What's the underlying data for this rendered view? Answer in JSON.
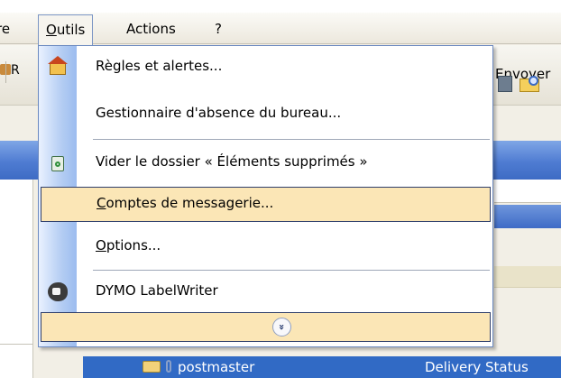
{
  "menubar": {
    "items": [
      {
        "label": "re"
      },
      {
        "label": "Outils"
      },
      {
        "label": "Actions"
      },
      {
        "label": "?"
      }
    ]
  },
  "toolbar": {
    "partial_left": "R",
    "partial_right": "Envoyer"
  },
  "dropdown": {
    "items": [
      {
        "label": "Règles et alertes...",
        "icon": "rules-icon"
      },
      {
        "label": "Gestionnaire d'absence du bureau..."
      },
      {
        "label": "Vider le dossier « Éléments supprimés »",
        "icon": "recycle-bin-icon"
      },
      {
        "label": "Comptes de messagerie...",
        "highlighted": true
      },
      {
        "label": "Options..."
      },
      {
        "label": "DYMO LabelWriter",
        "icon": "dymo-icon"
      }
    ],
    "expand_glyph": "»"
  },
  "message_row": {
    "from": "postmaster",
    "subject": "Delivery Status"
  },
  "colors": {
    "menu_highlight": "#fbe6b6",
    "selection_blue": "#316ac5",
    "icon_strip": "#b4cdf3"
  }
}
